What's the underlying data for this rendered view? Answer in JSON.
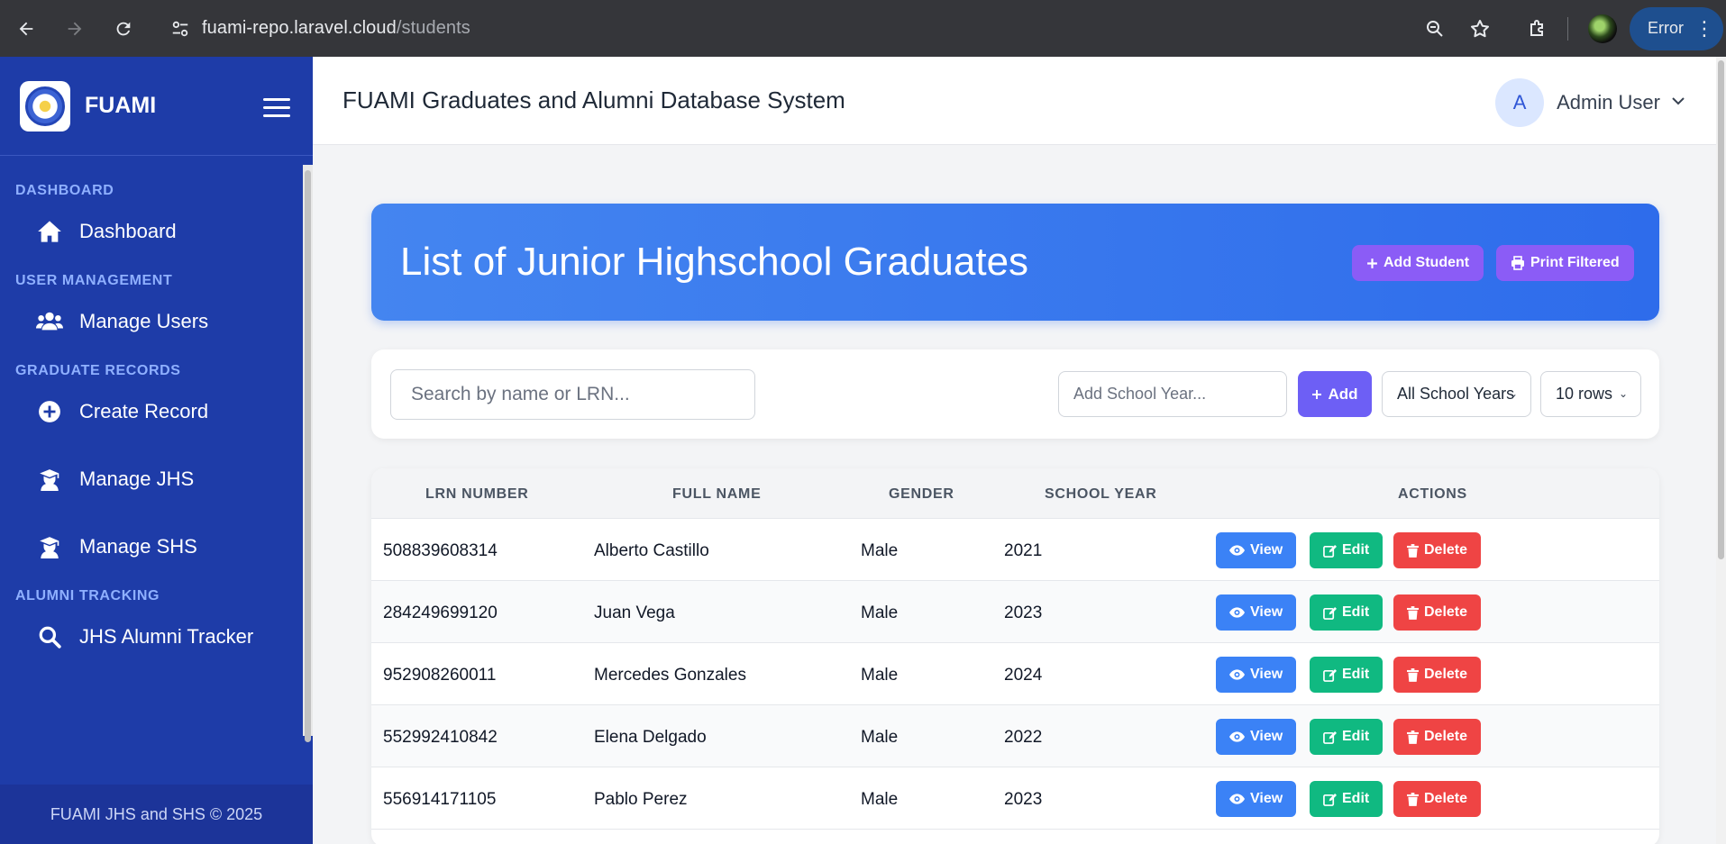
{
  "browser": {
    "url_host": "fuami-repo.laravel.cloud",
    "url_path": "/students",
    "profile_status": "Error"
  },
  "sidebar": {
    "brand": "FUAMI",
    "sections": [
      {
        "title": "DASHBOARD",
        "items": [
          {
            "label": "Dashboard",
            "icon": "home-icon"
          }
        ]
      },
      {
        "title": "USER MANAGEMENT",
        "items": [
          {
            "label": "Manage Users",
            "icon": "users-icon"
          }
        ]
      },
      {
        "title": "GRADUATE RECORDS",
        "items": [
          {
            "label": "Create Record",
            "icon": "plus-circle-icon"
          },
          {
            "label": "Manage JHS",
            "icon": "graduate-icon"
          },
          {
            "label": "Manage SHS",
            "icon": "graduate-icon"
          }
        ]
      },
      {
        "title": "ALUMNI TRACKING",
        "items": [
          {
            "label": "JHS Alumni Tracker",
            "icon": "search-icon"
          }
        ]
      }
    ],
    "footer": "FUAMI JHS and SHS © 2025"
  },
  "header": {
    "title": "FUAMI Graduates and Alumni Database System",
    "user_initial": "A",
    "user_name": "Admin User"
  },
  "hero": {
    "title": "List of Junior Highschool Graduates",
    "add_student": "Add Student",
    "print_filtered": "Print Filtered"
  },
  "filters": {
    "search_placeholder": "Search by name or LRN...",
    "school_year_placeholder": "Add School Year...",
    "add_label": "Add",
    "school_year_select": "All School Years",
    "rows_select": "10 rows"
  },
  "table": {
    "columns": [
      "LRN NUMBER",
      "FULL NAME",
      "GENDER",
      "SCHOOL YEAR",
      "ACTIONS"
    ],
    "action_labels": {
      "view": "View",
      "edit": "Edit",
      "delete": "Delete"
    },
    "rows": [
      {
        "lrn": "508839608314",
        "name": "Alberto Castillo",
        "gender": "Male",
        "year": "2021"
      },
      {
        "lrn": "284249699120",
        "name": "Juan Vega",
        "gender": "Male",
        "year": "2023"
      },
      {
        "lrn": "952908260011",
        "name": "Mercedes Gonzales",
        "gender": "Male",
        "year": "2024"
      },
      {
        "lrn": "552992410842",
        "name": "Elena Delgado",
        "gender": "Male",
        "year": "2022"
      },
      {
        "lrn": "556914171105",
        "name": "Pablo Perez",
        "gender": "Male",
        "year": "2023"
      }
    ]
  },
  "colors": {
    "sidebar": "#1e3ca8",
    "hero": "#3b7cef",
    "accent_purple": "#8b5cf6",
    "view": "#3b82f6",
    "edit": "#10b981",
    "delete": "#ef4444"
  }
}
